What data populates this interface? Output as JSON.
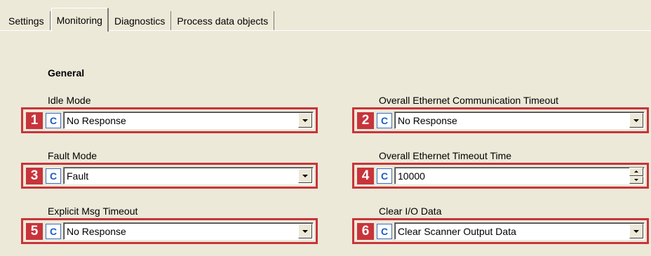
{
  "tabs": [
    {
      "label": "Settings",
      "active": false
    },
    {
      "label": "Monitoring",
      "active": true
    },
    {
      "label": "Diagnostics",
      "active": false
    },
    {
      "label": "Process data objects",
      "active": false
    }
  ],
  "section": {
    "title": "General"
  },
  "fields": {
    "idle_mode": {
      "label": "Idle Mode",
      "badge": "1",
      "c_label": "C",
      "value": "No Response",
      "control": "dropdown"
    },
    "overall_comm_timeout": {
      "label": "Overall Ethernet Communication Timeout",
      "badge": "2",
      "c_label": "C",
      "value": "No Response",
      "control": "dropdown"
    },
    "fault_mode": {
      "label": "Fault Mode",
      "badge": "3",
      "c_label": "C",
      "value": "Fault",
      "control": "dropdown"
    },
    "overall_timeout_time": {
      "label": "Overall Ethernet Timeout Time",
      "badge": "4",
      "c_label": "C",
      "value": "10000",
      "control": "spinner"
    },
    "explicit_msg_timeout": {
      "label": "Explicit Msg Timeout",
      "badge": "5",
      "c_label": "C",
      "value": "No Response",
      "control": "dropdown"
    },
    "clear_io_data": {
      "label": "Clear I/O Data",
      "badge": "6",
      "c_label": "C",
      "value": "Clear Scanner Output Data",
      "control": "dropdown"
    }
  },
  "colors": {
    "background": "#ece9d8",
    "highlight_frame": "#c8343b",
    "badge_bg": "#c8343b",
    "c_button_text": "#1c5bc4"
  },
  "icons": {
    "dropdown": "chevron-down-icon",
    "spinner_up": "arrow-up-icon",
    "spinner_down": "arrow-down-icon"
  }
}
